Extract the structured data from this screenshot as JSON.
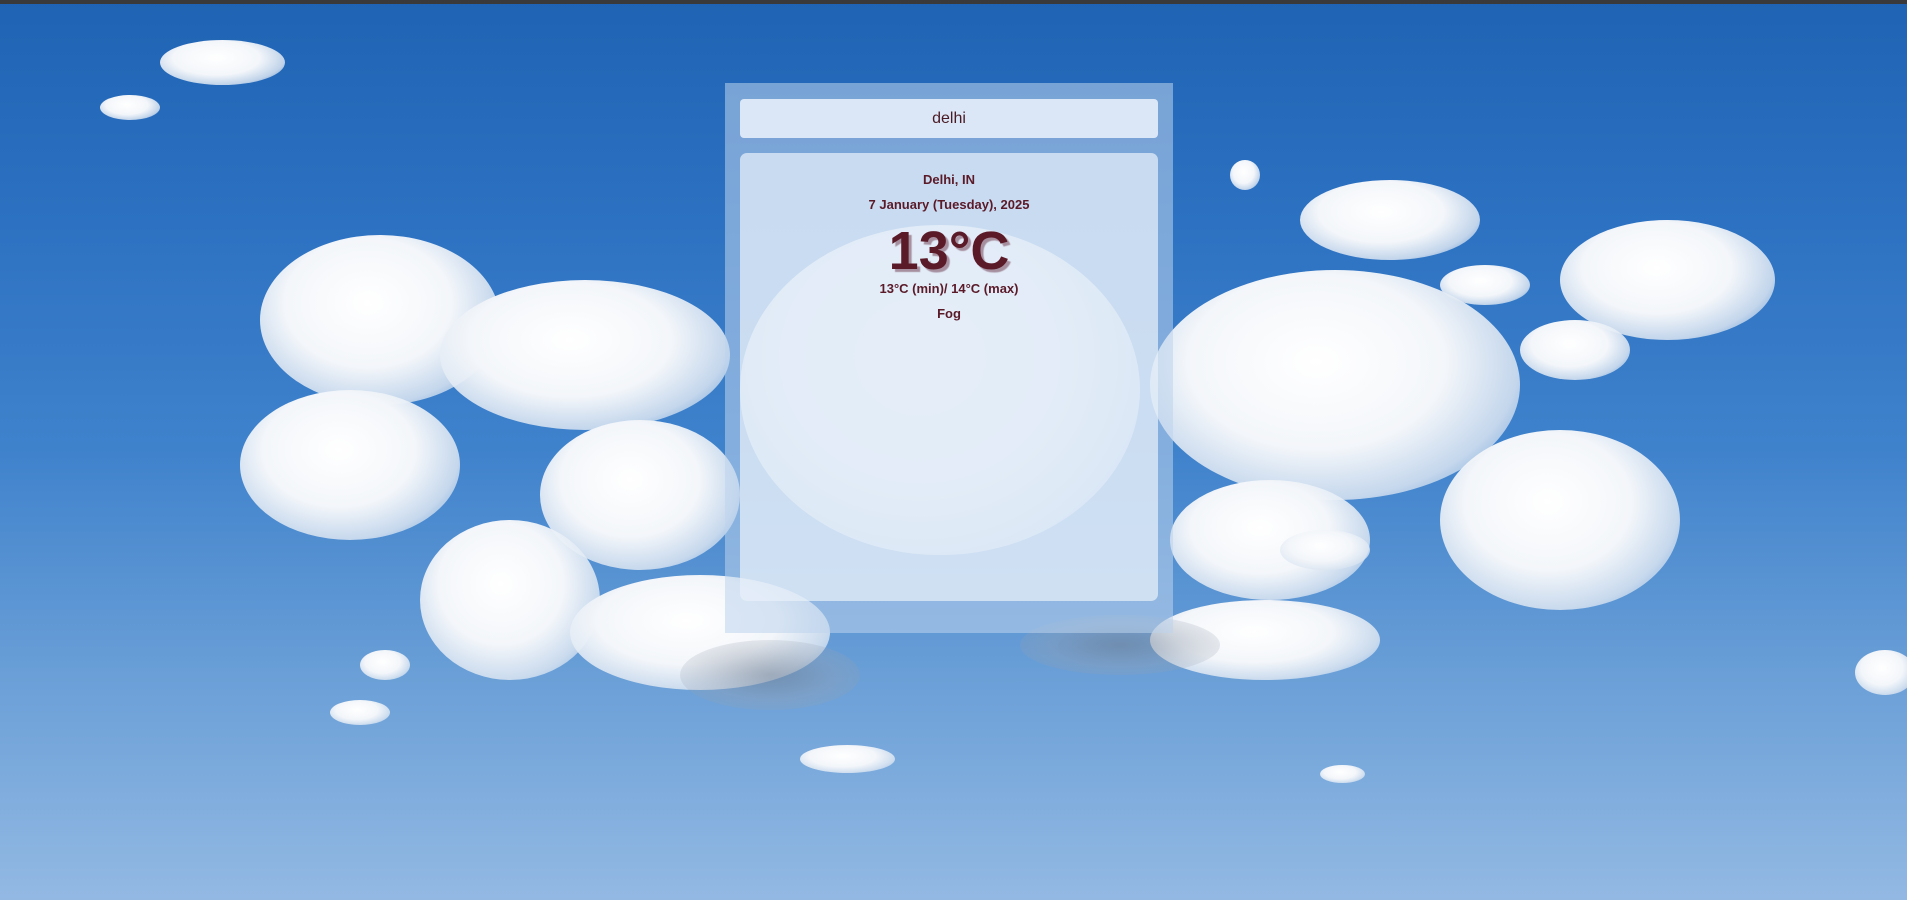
{
  "search": {
    "value": "delhi"
  },
  "weather": {
    "location": "Delhi, IN",
    "date": "7 January (Tuesday), 2025",
    "temperature": "13°C",
    "min_max": "13°C (min)/ 14°C (max)",
    "condition": "Fog"
  },
  "colors": {
    "text": "#5a1a28",
    "sky_top": "#1f63b4",
    "sky_bottom": "#93b9e3"
  }
}
